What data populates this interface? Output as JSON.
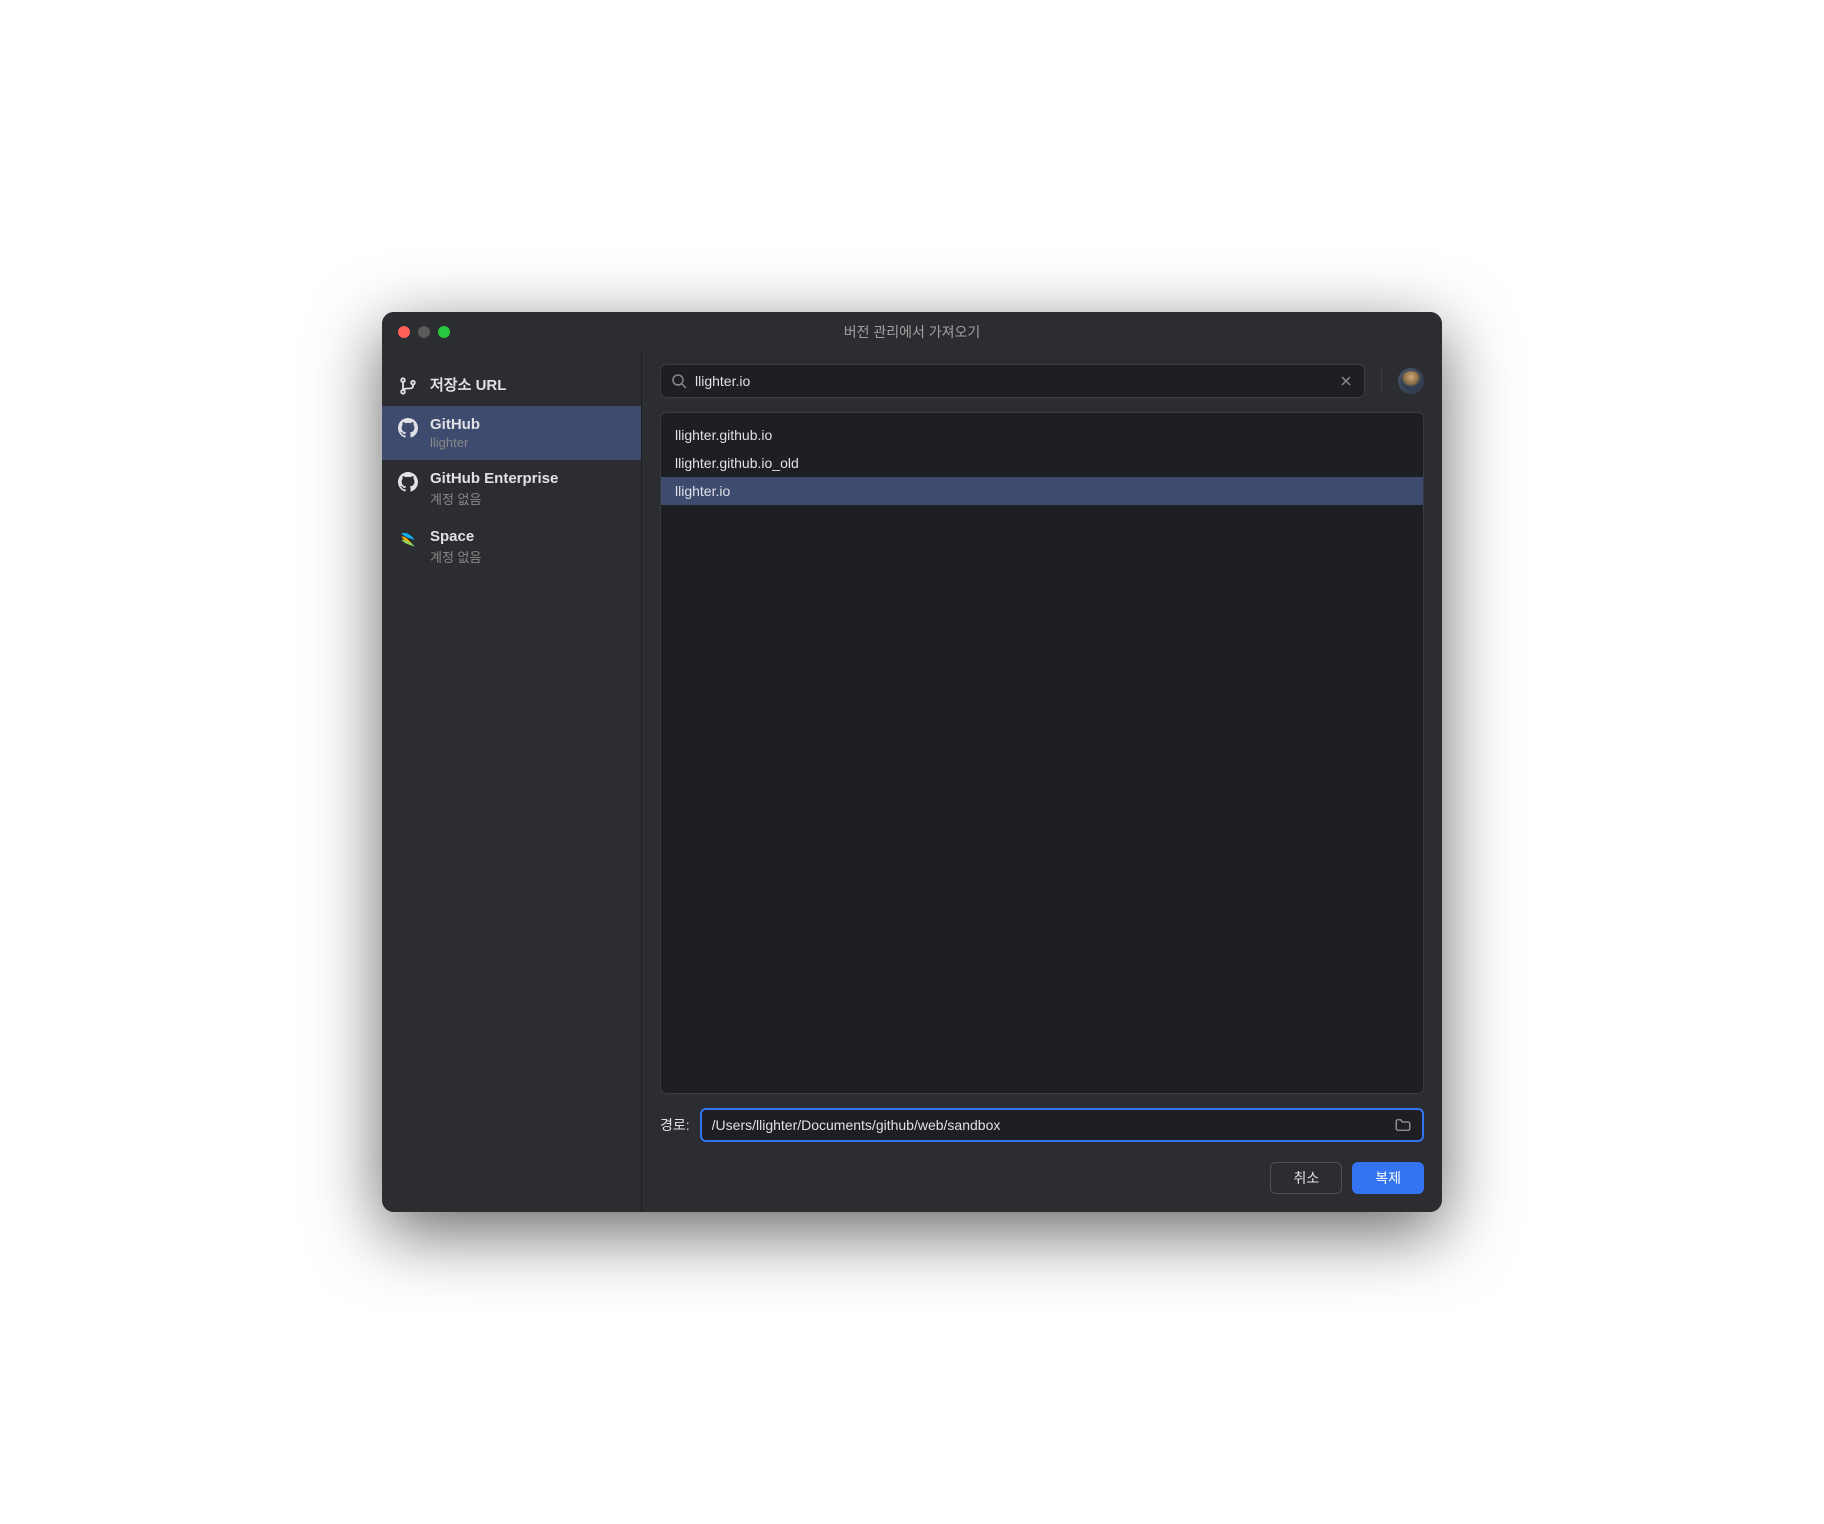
{
  "window": {
    "title": "버전 관리에서 가져오기"
  },
  "sidebar": {
    "items": [
      {
        "title": "저장소 URL",
        "subtitle": ""
      },
      {
        "title": "GitHub",
        "subtitle": "llighter"
      },
      {
        "title": "GitHub Enterprise",
        "subtitle": "계정 없음"
      },
      {
        "title": "Space",
        "subtitle": "계정 없음"
      }
    ]
  },
  "search": {
    "value": "llighter.io"
  },
  "results": [
    "llighter.github.io",
    "llighter.github.io_old",
    "llighter.io"
  ],
  "path": {
    "label": "경로:",
    "value": "/Users/llighter/Documents/github/web/sandbox"
  },
  "buttons": {
    "cancel": "취소",
    "clone": "복제"
  }
}
